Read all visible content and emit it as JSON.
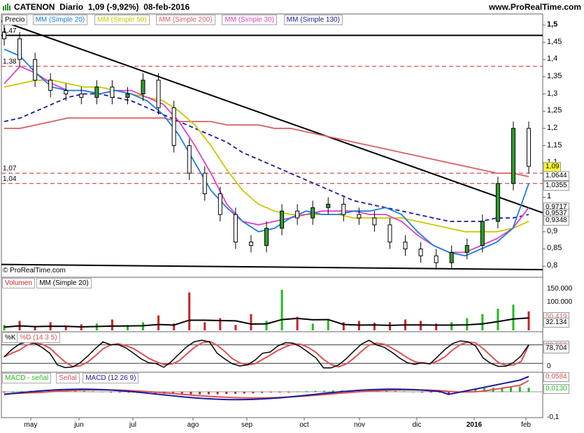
{
  "header": {
    "instrument": "CATENON",
    "period": "Diario",
    "last": "1,09 (-9,92%)",
    "date": "08-feb-2016",
    "site": "www.ProRealTime.com"
  },
  "colors": {
    "price_bars": "#000000",
    "sma20": "#1e7be0",
    "sma50": "#c8c800",
    "sma200": "#d96060",
    "sma30": "#e040c0",
    "sma130": "#1a1aa0",
    "volume_up": "#22bb22",
    "volume_down": "#cc2222",
    "stoch_k": "#000000",
    "stoch_d": "#e05050",
    "macd": "#1a1aa0",
    "macd_signal": "#e05050",
    "macd_hist": "#22bb22"
  },
  "price_panel": {
    "legend": [
      "Precio",
      "MM (Simple 20)",
      "MM (Simple 50)",
      "MM (Simple 200)",
      "MM (Simple 30)",
      "MM (Simple 130)"
    ],
    "y_ticks": [
      "1,5",
      "1,45",
      "1,4",
      "1,35",
      "1,3",
      "1,25",
      "1,2",
      "1,15",
      "1,1",
      "1,05",
      "1",
      "0,95",
      "0,9",
      "0,85",
      "0,8"
    ],
    "left_labels": [
      "1,47",
      "1,38",
      "1,07",
      "1,04"
    ],
    "right_tags": [
      {
        "text": "1,09",
        "bg": "#ffff33"
      },
      {
        "text": "1,0644",
        "bg": "#ffffff"
      },
      {
        "text": "1,0355",
        "bg": "#ffffff"
      },
      {
        "text": "0,9717",
        "bg": "#ffffff"
      },
      {
        "text": "0,9537",
        "bg": "#ffffff"
      },
      {
        "text": "0,9348",
        "bg": "#ffffff"
      }
    ],
    "copyright": "© ProRealTime.com"
  },
  "volume_panel": {
    "legend": [
      "Volumen",
      "MM (Simple 20)"
    ],
    "y_ticks": [
      "150.000",
      "100.000"
    ],
    "right_tags": [
      "50.419",
      "32.134"
    ]
  },
  "stoch_panel": {
    "legend": [
      "%K",
      "%D (14 3 5)"
    ],
    "y_ticks": [
      "0"
    ],
    "right_tags": [
      "80,556",
      "78,704"
    ]
  },
  "macd_panel": {
    "legend": [
      "MACD - señal",
      "Señal",
      "MACD (12 26 9)"
    ],
    "y_ticks": [
      "-0,1"
    ],
    "right_tags": [
      "0,0584",
      "0,0130"
    ]
  },
  "x_axis": {
    "months": [
      "may",
      "jun",
      "jul",
      "ago",
      "sep",
      "oct",
      "nov",
      "dic",
      "2016",
      "feb"
    ]
  },
  "chart_data": {
    "type": "candlestick",
    "x_months": [
      "may",
      "jun",
      "jul",
      "ago",
      "sep",
      "oct",
      "nov",
      "dic",
      "2016",
      "feb"
    ],
    "ylim": [
      0.78,
      1.52
    ],
    "horizontal_levels": [
      1.47,
      1.38,
      1.07,
      1.04
    ],
    "last_close": 1.09,
    "sma20": [
      1.43,
      1.41,
      1.36,
      1.32,
      1.31,
      1.31,
      1.3,
      1.31,
      1.3,
      1.28,
      1.24,
      1.18,
      1.1,
      1.02,
      0.97,
      0.93,
      0.9,
      0.91,
      0.94,
      0.96,
      0.95,
      0.95,
      0.96,
      0.96,
      0.97,
      0.95,
      0.9,
      0.86,
      0.84,
      0.83,
      0.85,
      0.87,
      0.91,
      1.04
    ],
    "sma50": [
      1.32,
      1.33,
      1.34,
      1.34,
      1.33,
      1.32,
      1.32,
      1.31,
      1.3,
      1.29,
      1.28,
      1.25,
      1.21,
      1.15,
      1.08,
      1.02,
      0.98,
      0.96,
      0.95,
      0.95,
      0.95,
      0.95,
      0.94,
      0.94,
      0.94,
      0.94,
      0.93,
      0.92,
      0.91,
      0.9,
      0.9,
      0.9,
      0.91,
      0.93
    ],
    "sma200": [
      1.2,
      1.2,
      1.21,
      1.22,
      1.23,
      1.23,
      1.23,
      1.23,
      1.23,
      1.23,
      1.23,
      1.22,
      1.22,
      1.22,
      1.21,
      1.21,
      1.21,
      1.2,
      1.2,
      1.19,
      1.18,
      1.17,
      1.16,
      1.15,
      1.14,
      1.13,
      1.12,
      1.11,
      1.1,
      1.09,
      1.08,
      1.07,
      1.07,
      1.06
    ],
    "sma30": [
      1.33,
      1.38,
      1.36,
      1.33,
      1.31,
      1.31,
      1.3,
      1.31,
      1.31,
      1.29,
      1.27,
      1.22,
      1.15,
      1.07,
      0.98,
      0.93,
      0.92,
      0.93,
      0.94,
      0.95,
      0.96,
      0.96,
      0.96,
      0.95,
      0.95,
      0.93,
      0.89,
      0.86,
      0.84,
      0.84,
      0.86,
      0.88,
      0.91,
      0.97
    ],
    "sma130": [
      1.22,
      1.23,
      1.25,
      1.27,
      1.29,
      1.3,
      1.3,
      1.29,
      1.28,
      1.26,
      1.24,
      1.22,
      1.2,
      1.18,
      1.16,
      1.13,
      1.11,
      1.09,
      1.07,
      1.05,
      1.03,
      1.01,
      0.99,
      0.98,
      0.97,
      0.96,
      0.95,
      0.94,
      0.93,
      0.93,
      0.93,
      0.94,
      0.94,
      0.95
    ],
    "closes": [
      1.46,
      1.4,
      1.34,
      1.31,
      1.3,
      1.29,
      1.32,
      1.29,
      1.3,
      1.34,
      1.26,
      1.15,
      1.07,
      1.01,
      0.95,
      0.87,
      0.86,
      0.91,
      0.96,
      0.94,
      0.97,
      0.98,
      0.95,
      0.94,
      0.92,
      0.87,
      0.85,
      0.83,
      0.81,
      0.84,
      0.86,
      0.93,
      1.04,
      1.2,
      1.09
    ],
    "volume": [
      20,
      35,
      15,
      30,
      18,
      22,
      25,
      40,
      20,
      30,
      55,
      25,
      140,
      30,
      45,
      20,
      60,
      35,
      150,
      50,
      25,
      40,
      30,
      35,
      28,
      30,
      40,
      35,
      25,
      30,
      45,
      60,
      80,
      95,
      70
    ],
    "volume_sma20_last": 32.134,
    "stoch_k_last": 80.556,
    "stoch_d_last": 78.704,
    "macd_last": 0.0584,
    "macd_signal_last": 0.013
  }
}
